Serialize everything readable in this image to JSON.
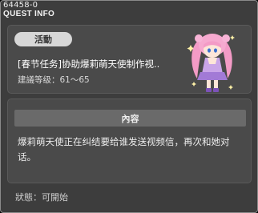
{
  "window": {
    "quest_id": "64458-0",
    "title": "QUEST INFO"
  },
  "quest": {
    "category": "活動",
    "name": "[春节任务]协助爆莉萌天使制作视..",
    "level_label": "建議等级：",
    "level_range": "61～65"
  },
  "details": {
    "section_title": "內容",
    "description": "爆莉萌天使正在纠结要给谁发送视频信，再次和她对话。"
  },
  "status": {
    "label": "狀態：",
    "value": "可開始"
  },
  "colors": {
    "window_bg": "#3d3d3d",
    "card_bg": "#4a4a4a",
    "pill_bg": "#d7d7d7",
    "header_bg": "#6a6a6a",
    "npc_hair": "#f39bc6",
    "npc_outfit": "#c9a5e8"
  }
}
